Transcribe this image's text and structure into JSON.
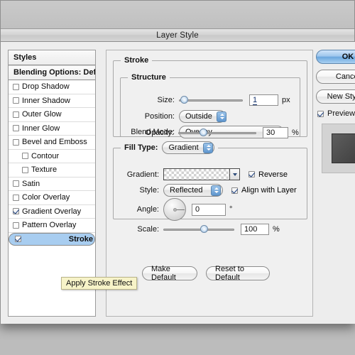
{
  "window": {
    "title": "Layer Style"
  },
  "styles_panel": {
    "header": "Styles",
    "blending_options": "Blending Options: Default",
    "items": [
      {
        "label": "Drop Shadow",
        "checked": false,
        "sub": false,
        "selected": false
      },
      {
        "label": "Inner Shadow",
        "checked": false,
        "sub": false,
        "selected": false
      },
      {
        "label": "Outer Glow",
        "checked": false,
        "sub": false,
        "selected": false
      },
      {
        "label": "Inner Glow",
        "checked": false,
        "sub": false,
        "selected": false
      },
      {
        "label": "Bevel and Emboss",
        "checked": false,
        "sub": false,
        "selected": false
      },
      {
        "label": "Contour",
        "checked": false,
        "sub": true,
        "selected": false
      },
      {
        "label": "Texture",
        "checked": false,
        "sub": true,
        "selected": false
      },
      {
        "label": "Satin",
        "checked": false,
        "sub": false,
        "selected": false
      },
      {
        "label": "Color Overlay",
        "checked": false,
        "sub": false,
        "selected": false
      },
      {
        "label": "Gradient Overlay",
        "checked": true,
        "sub": false,
        "selected": false
      },
      {
        "label": "Pattern Overlay",
        "checked": false,
        "sub": false,
        "selected": false
      },
      {
        "label": "Stroke",
        "checked": true,
        "sub": false,
        "selected": true
      }
    ]
  },
  "stroke": {
    "group_title": "Stroke",
    "structure": {
      "group_title": "Structure",
      "size_label": "Size:",
      "size_value": "1",
      "size_unit": "px",
      "size_percent": 3,
      "position_label": "Position:",
      "position_value": "Outside",
      "blend_mode_label": "Blend Mode:",
      "blend_mode_value": "Overlay",
      "opacity_label": "Opacity:",
      "opacity_value": "30",
      "opacity_unit": "%",
      "opacity_percent": 30
    },
    "fill": {
      "group_title": "Fill Type:",
      "fill_type_value": "Gradient",
      "gradient_label": "Gradient:",
      "reverse_label": "Reverse",
      "reverse_checked": true,
      "style_label": "Style:",
      "style_value": "Reflected",
      "align_label": "Align with Layer",
      "align_checked": true,
      "angle_label": "Angle:",
      "angle_value": "0",
      "angle_unit": "°",
      "angle_degrees": 0,
      "scale_label": "Scale:",
      "scale_value": "100",
      "scale_unit": "%",
      "scale_percent": 58
    }
  },
  "buttons": {
    "make_default": "Make Default",
    "reset_to_default": "Reset to Default",
    "ok": "OK",
    "cancel": "Cancel",
    "new_style": "New Style...",
    "preview_label": "Preview",
    "preview_checked": true
  },
  "tooltip": {
    "text": "Apply Stroke Effect"
  },
  "colors": {
    "selection": "#a8cdf0",
    "accent_button": "#6ba7de",
    "tooltip_bg": "#f7f3c8",
    "dialog_bg": "#ededed",
    "desktop_bg": "#bdbdbd"
  }
}
